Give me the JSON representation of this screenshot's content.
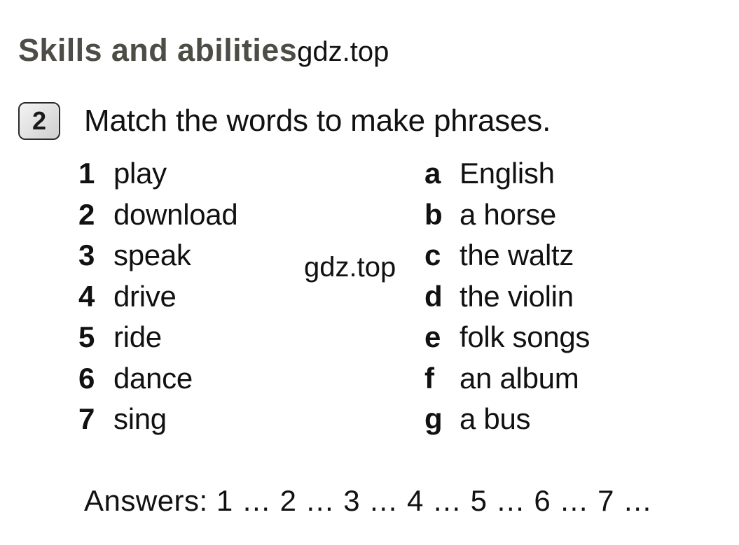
{
  "header": {
    "title": "Skills and abilities",
    "watermark": "gdz.top"
  },
  "exercise": {
    "number": "2",
    "instruction": "Match the words to make phrases."
  },
  "match": {
    "left_column": [
      {
        "key": "1",
        "value": "play"
      },
      {
        "key": "2",
        "value": "download"
      },
      {
        "key": "3",
        "value": "speak"
      },
      {
        "key": "4",
        "value": "drive"
      },
      {
        "key": "5",
        "value": "ride"
      },
      {
        "key": "6",
        "value": "dance"
      },
      {
        "key": "7",
        "value": "sing"
      }
    ],
    "right_column": [
      {
        "key": "a",
        "value": "English"
      },
      {
        "key": "b",
        "value": "a horse"
      },
      {
        "key": "c",
        "value": "the waltz"
      },
      {
        "key": "d",
        "value": "the violin"
      },
      {
        "key": "e",
        "value": "folk songs"
      },
      {
        "key": "f",
        "value": "an album"
      },
      {
        "key": "g",
        "value": "a bus"
      }
    ]
  },
  "center_watermark": "gdz.top",
  "answers": {
    "line": "Answers: 1 … 2 … 3 … 4 … 5 … 6 … 7 …"
  },
  "colors": {
    "page_background": "#ffffff",
    "body_text": "#111111",
    "title_text": "#4d4d46",
    "number_box_border": "#2a2a2a",
    "number_box_fill": "#e3e3e3"
  }
}
